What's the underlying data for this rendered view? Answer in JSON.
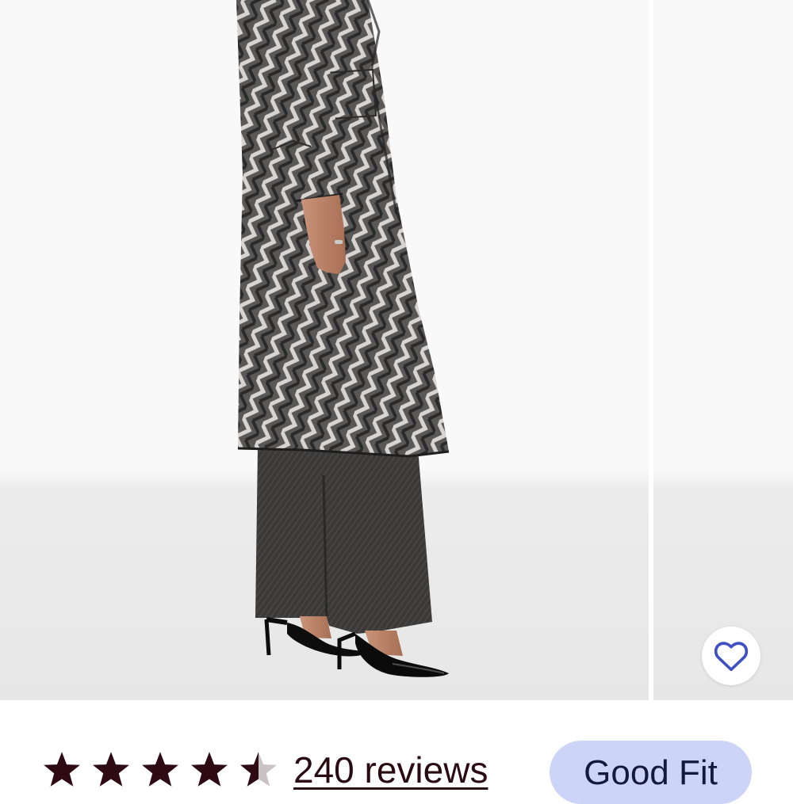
{
  "product": {
    "image_alt": "Model wearing a long grey herringbone wool coat over wide-leg grey trousers with black patent pumps"
  },
  "favorite": {
    "icon": "heart-outline-icon",
    "color": "#3f4fc4"
  },
  "rating": {
    "stars_value": 4.5,
    "stars_max": 5,
    "star_color": "#2e0a15",
    "reviews_label": "240 reviews"
  },
  "fit_badge": {
    "label": "Good Fit",
    "background": "#ccd4f7"
  }
}
